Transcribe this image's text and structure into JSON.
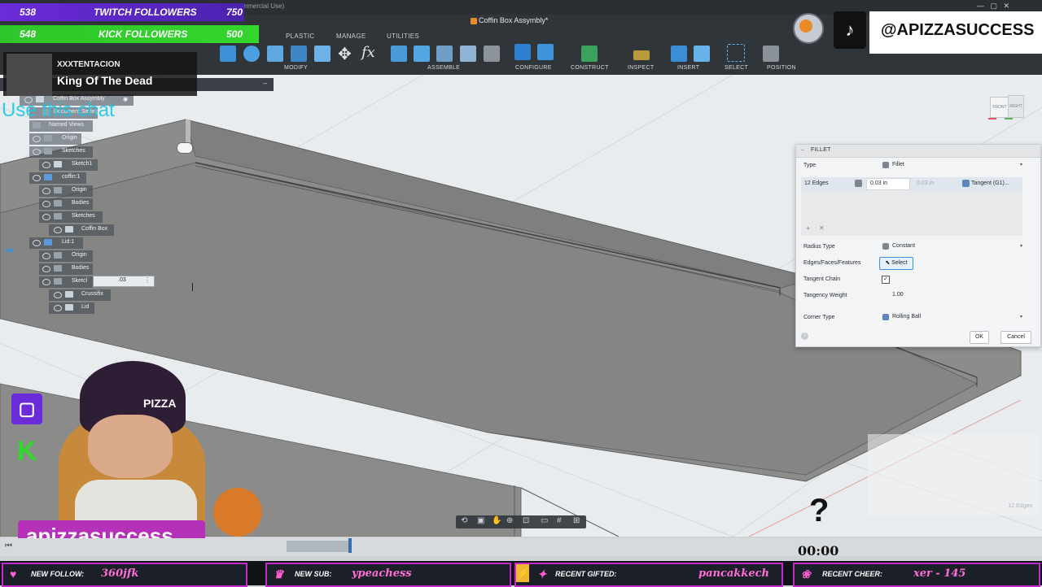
{
  "window": {
    "title": "Coffin Box Assymbly*",
    "bg_title_fragment": "ersonal (Not for Commercial Use)"
  },
  "toolbar": {
    "tabs": [
      "PLASTIC",
      "MANAGE",
      "UTILITIES"
    ],
    "groups": [
      "MODIFY",
      "ASSEMBLE",
      "CONFIGURE",
      "CONSTRUCT",
      "INSPECT",
      "INSERT",
      "SELECT",
      "POSITION"
    ]
  },
  "stream_overlay": {
    "twitch_count": "538",
    "twitch_label": "TWITCH FOLLOWERS",
    "twitch_goal": "750",
    "kick_count": "548",
    "kick_label": "KICK FOLLOWERS",
    "kick_goal": "500",
    "artist": "XXXTENTACION",
    "song": "King Of The Dead",
    "chat_hint": "Use this chat",
    "tiktok_handle": "@APIZZASUCCESS",
    "username": "apizzasuccess",
    "hat_text": "PIZZA",
    "timer": "00:00",
    "question_mark": "?",
    "bottom_bar": [
      {
        "label": "NEW FOLLOW:",
        "value": "360jfk"
      },
      {
        "label": "NEW SUB:",
        "value": "ypeachess"
      },
      {
        "label": "RECENT GIFTED:",
        "value": "pancakkech"
      },
      {
        "label": "RECENT CHEER:",
        "value": "xer - 145"
      }
    ]
  },
  "browser": {
    "root": "Coffin Box Assymbly",
    "items": [
      {
        "label": "Document Settings"
      },
      {
        "label": "Named Views"
      },
      {
        "label": "Origin"
      },
      {
        "label": "Sketches"
      },
      {
        "label": "Sketch1"
      },
      {
        "label": "coffin:1"
      },
      {
        "label": "Origin"
      },
      {
        "label": "Bodies"
      },
      {
        "label": "Sketches"
      },
      {
        "label": "Coffin Box"
      },
      {
        "label": "Lid:1"
      },
      {
        "label": "Origin"
      },
      {
        "label": "Bodies"
      },
      {
        "label": "Sketcl"
      },
      {
        "label": "Crussifix"
      },
      {
        "label": "Lid"
      }
    ],
    "inline_input": ".03"
  },
  "fillet": {
    "title": "FILLET",
    "type_label": "Type",
    "type_value": "Fillet",
    "edges_label": "12 Edges",
    "radius_value": "0.03 in",
    "radius_ghost": "0.03 in",
    "continuity": "Tangent (G1)...",
    "radius_type_label": "Radius Type",
    "radius_type_value": "Constant",
    "edges_faces_label": "Edges/Faces/Features",
    "select_label": "Select",
    "tangent_chain_label": "Tangent Chain",
    "tangency_weight_label": "Tangency Weight",
    "tangency_weight_value": "1.00",
    "corner_type_label": "Corner Type",
    "corner_type_value": "Rolling Ball",
    "ok": "OK",
    "cancel": "Cancel"
  },
  "viewcube": {
    "front": "FRONT",
    "right": "RIGHT"
  },
  "ghost_notice": {
    "count": "12 Edges"
  },
  "colors": {
    "twitch": "#6b2bd9",
    "kick": "#33d62c",
    "accent": "#c42ac9",
    "panel_bg": "#f3f4f5",
    "model": "#8c8c8a"
  }
}
